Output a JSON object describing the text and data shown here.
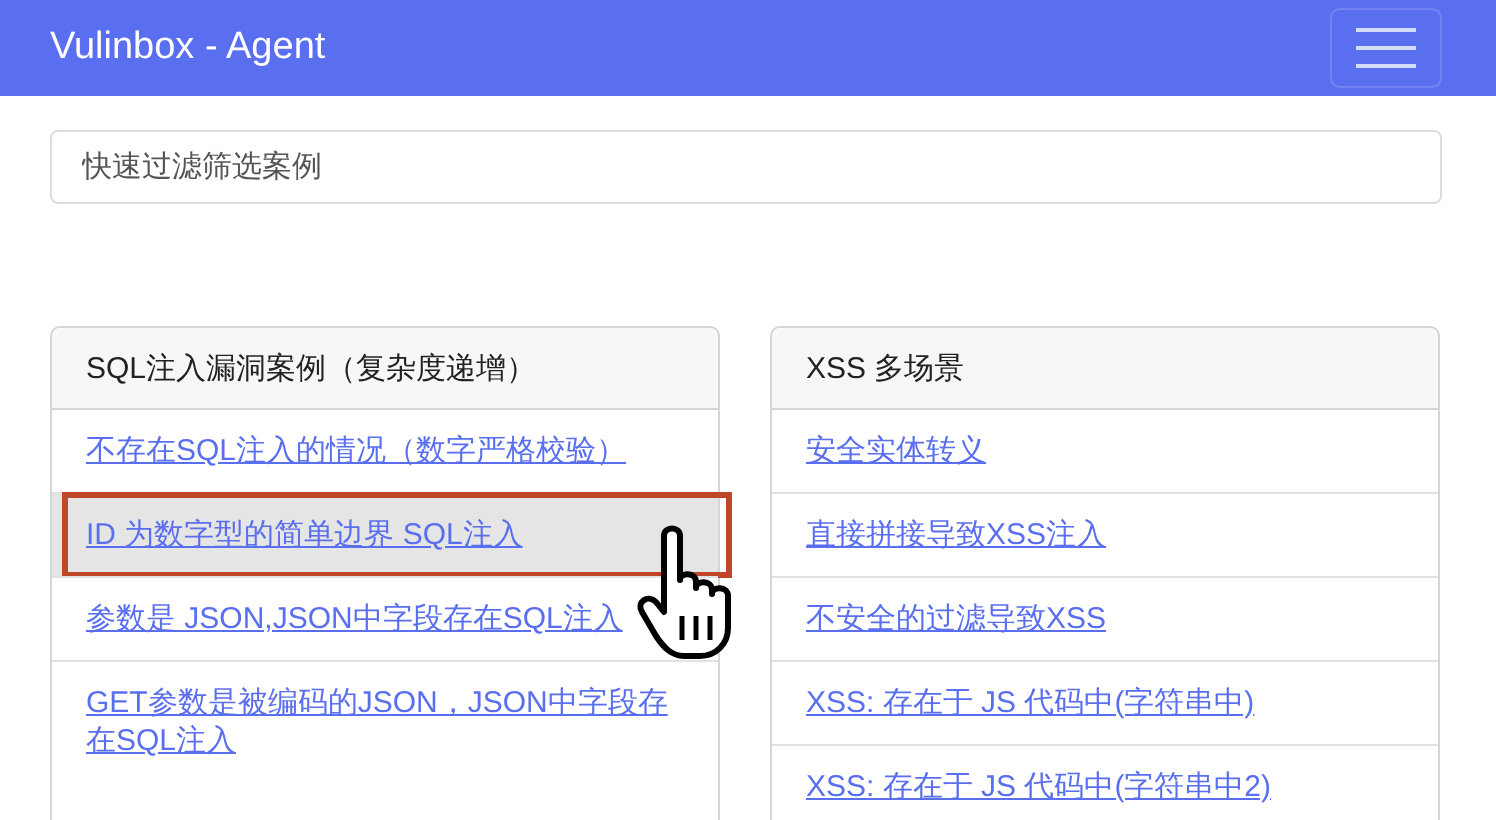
{
  "navbar": {
    "brand": "Vulinbox - Agent"
  },
  "search": {
    "placeholder": "快速过滤筛选案例"
  },
  "cards": [
    {
      "title": "SQL注入漏洞案例（复杂度递增）",
      "items": [
        {
          "label": "不存在SQL注入的情况（数字严格校验）",
          "selected": false
        },
        {
          "label": "ID 为数字型的简单边界 SQL注入",
          "selected": true
        },
        {
          "label": "参数是 JSON,JSON中字段存在SQL注入",
          "selected": false
        },
        {
          "label": "GET参数是被编码的JSON，JSON中字段存在SQL注入",
          "selected": false
        }
      ]
    },
    {
      "title": "XSS 多场景",
      "items": [
        {
          "label": "安全实体转义",
          "selected": false
        },
        {
          "label": "直接拼接导致XSS注入",
          "selected": false
        },
        {
          "label": "不安全的过滤导致XSS",
          "selected": false
        },
        {
          "label": "XSS: 存在于 JS 代码中(字符串中)",
          "selected": false
        },
        {
          "label": "XSS: 存在于 JS 代码中(字符串中2)",
          "selected": false
        }
      ]
    }
  ]
}
